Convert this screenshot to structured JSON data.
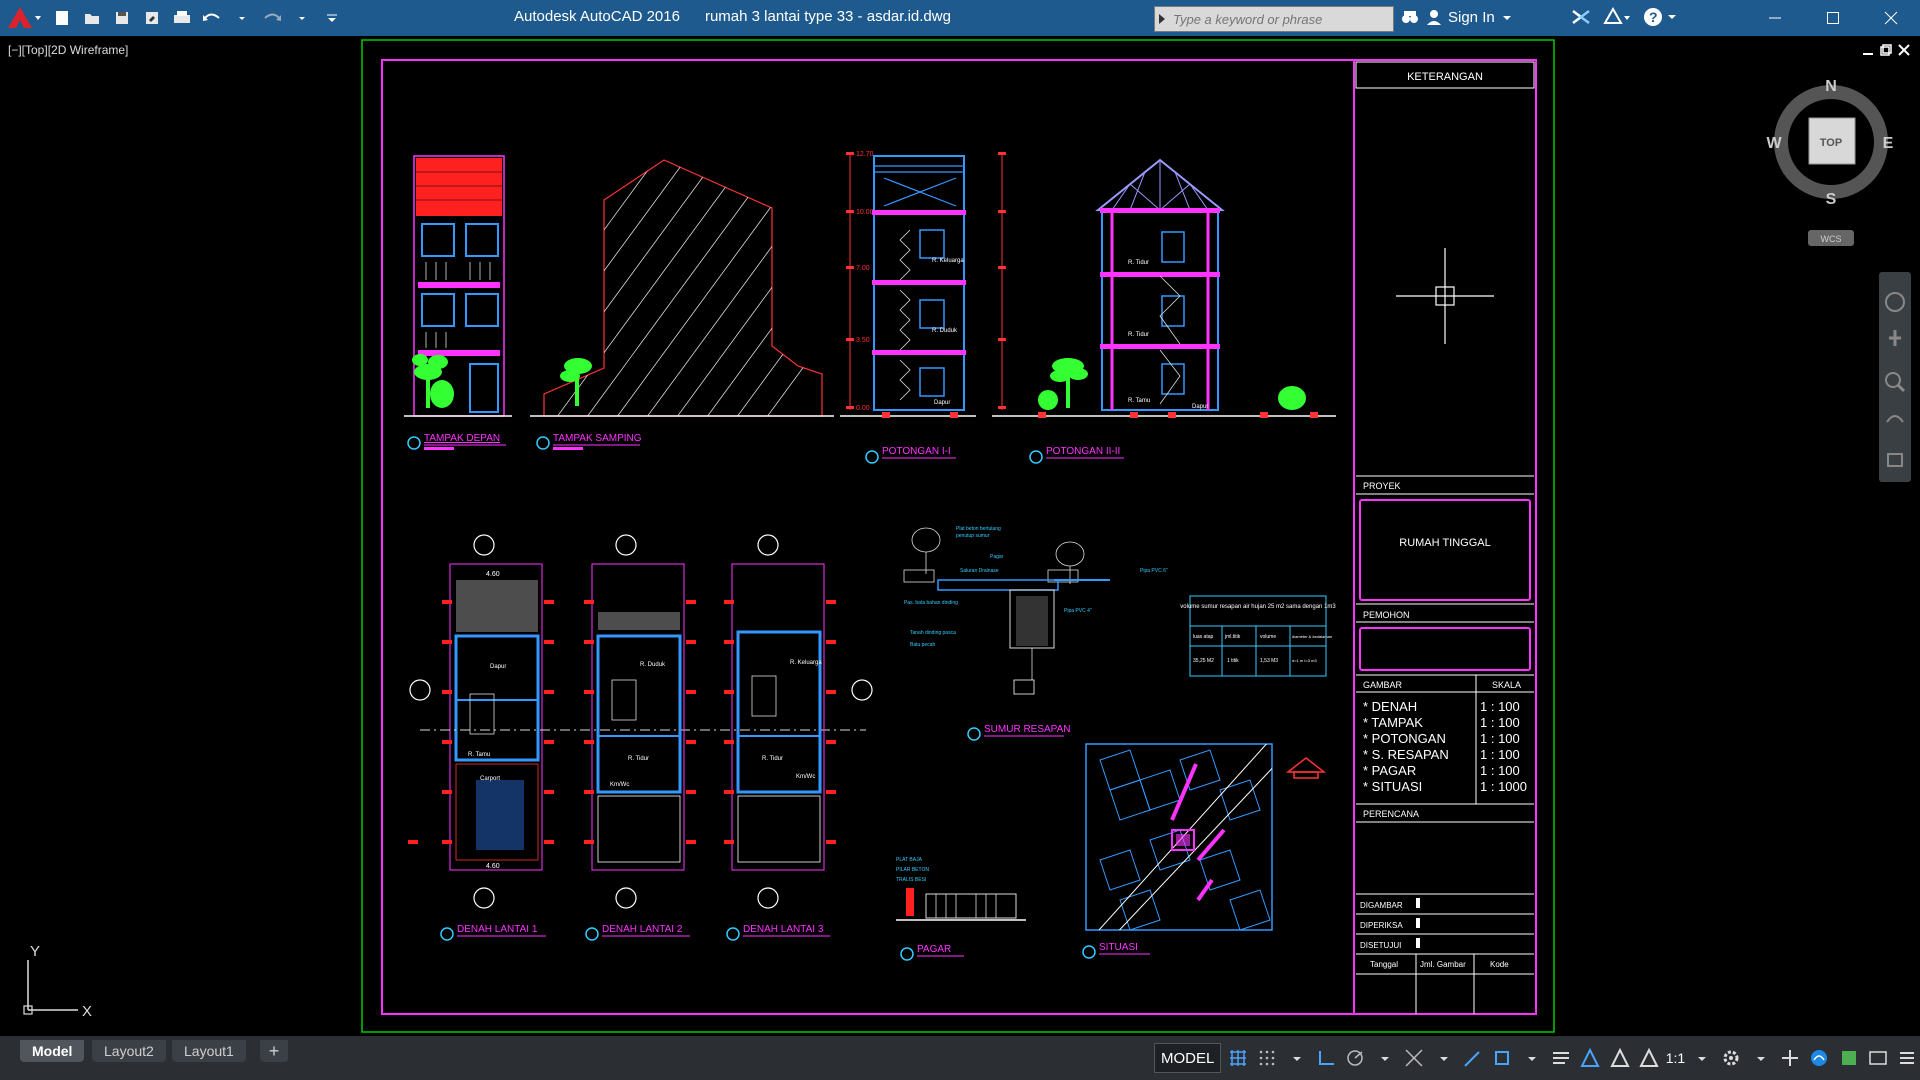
{
  "app": {
    "title": "Autodesk AutoCAD 2016",
    "document": "rumah 3 lantai type 33 - asdar.id.dwg",
    "search_placeholder": "Type a keyword or phrase",
    "sign_in": "Sign In",
    "accent": "#1e5a8e"
  },
  "viewport": {
    "label": "[−][Top][2D Wireframe]"
  },
  "navcube": {
    "north": "N",
    "south": "S",
    "east": "E",
    "west": "W",
    "face": "TOP",
    "ucs_menu": "WCS"
  },
  "ucs": {
    "y": "Y",
    "x": "X"
  },
  "drawing": {
    "views": {
      "front": "TAMPAK DEPAN",
      "side": "TAMPAK SAMPING",
      "section1": "POTONGAN I-I",
      "section2": "POTONGAN II-II",
      "plan1": "DENAH LANTAI 1",
      "plan2": "DENAH LANTAI 2",
      "plan3": "DENAH LANTAI 3",
      "well": "SUMUR RESAPAN",
      "fence": "PAGAR",
      "site": "SITUASI"
    },
    "rooms": {
      "r_keluarga": "R. Keluarga",
      "r_duduk": "R. Duduk",
      "r_tidur": "R. Tidur",
      "r_tamu": "R. Tamu",
      "dapur": "Dapur",
      "carport": "Carport",
      "kmwc": "Km/Wc"
    },
    "dims": {
      "width": "4.60",
      "depth": "4.50",
      "elev": [
        "12.70",
        "10.00",
        "7.00",
        "3.50",
        "0.00"
      ]
    },
    "well_notes": [
      "Plat beton bertulang",
      "penutup sumur",
      "Pagar",
      "Saluran Drainase",
      "Pas. bata bahan dinding",
      "Tanah dinding pasca",
      "Batu pecah",
      "Pipa PVC 4\"",
      "Pipa PVC 6\""
    ],
    "well_table": {
      "title": "volume sumur resapan air hujan 25 m2 sama dengan 1m3",
      "headers": [
        "luas atap",
        "jml.titik",
        "volume",
        "diameter & kedalaman"
      ],
      "row": [
        "35,25 M2",
        "1 titik",
        "1,53 M3",
        "d=1 m t=3 m3"
      ]
    },
    "fence_notes": [
      "PLAT BAJA",
      "PILAR BETON",
      "TRALIS BESI"
    ]
  },
  "titleblock": {
    "keterangan": "KETERANGAN",
    "proyek_label": "PROYEK",
    "proyek": "RUMAH TINGGAL",
    "pemohon_label": "PEMOHON",
    "gambar_label": "GAMBAR",
    "skala_label": "SKALA",
    "items": [
      {
        "name": "* DENAH",
        "scale": "1 : 100"
      },
      {
        "name": "* TAMPAK",
        "scale": "1 : 100"
      },
      {
        "name": "* POTONGAN",
        "scale": "1 : 100"
      },
      {
        "name": "* S. RESAPAN",
        "scale": "1 : 100"
      },
      {
        "name": "* PAGAR",
        "scale": "1 : 100"
      },
      {
        "name": "* SITUASI",
        "scale": "1 : 1000"
      }
    ],
    "perencana_label": "PERENCANA",
    "digambar": "DIGAMBAR",
    "diperiksa": "DIPERIKSA",
    "disetujui": "DISETUJUI",
    "tanggal": "Tanggal",
    "jml_gambar": "Jml. Gambar",
    "kode": "Kode"
  },
  "tabs": [
    {
      "label": "Model"
    },
    {
      "label": "Layout2"
    },
    {
      "label": "Layout1"
    },
    {
      "label": "+"
    }
  ],
  "status": {
    "model": "MODEL",
    "scale": "1:1"
  }
}
